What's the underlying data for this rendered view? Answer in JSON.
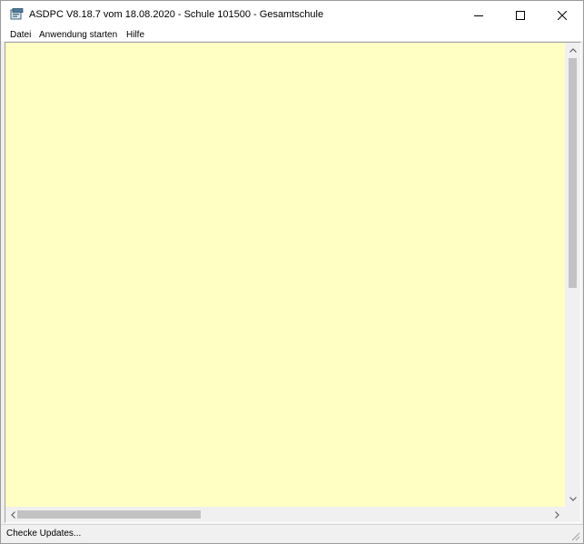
{
  "window": {
    "title": "ASDPC V8.18.7 vom 18.08.2020 - Schule 101500 - Gesamtschule",
    "app_icon": "asdpc-app-icon",
    "controls": {
      "minimize_icon": "minimize-icon",
      "maximize_icon": "maximize-icon",
      "close_icon": "close-icon"
    }
  },
  "menubar": {
    "items": [
      {
        "label": "Datei"
      },
      {
        "label": "Anwendung starten"
      },
      {
        "label": "Hilfe"
      }
    ]
  },
  "content": {
    "background_color": "#ffffc4"
  },
  "scrollbars": {
    "vertical": {
      "position": 0.0
    },
    "horizontal": {
      "position": 0.0
    }
  },
  "statusbar": {
    "text": "Checke Updates..."
  }
}
